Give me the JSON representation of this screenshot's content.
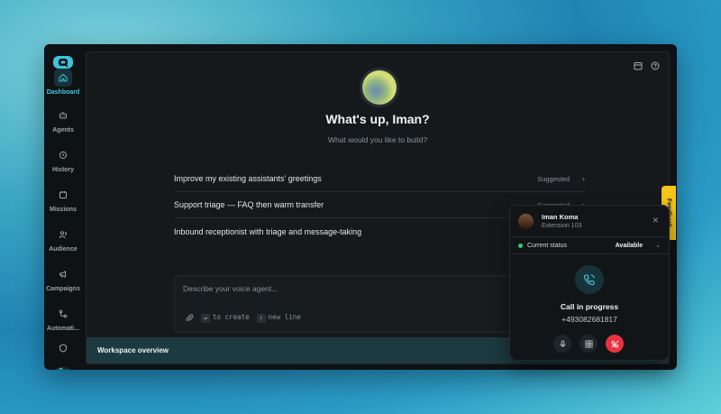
{
  "sidebar": {
    "items": [
      {
        "label": "Dashboard",
        "icon": "home-icon",
        "active": true
      },
      {
        "label": "Agents",
        "icon": "robot-icon"
      },
      {
        "label": "History",
        "icon": "history-icon"
      },
      {
        "label": "Missions",
        "icon": "calendar-clock-icon"
      },
      {
        "label": "Audience",
        "icon": "users-icon"
      },
      {
        "label": "Campaigns",
        "icon": "megaphone-icon"
      },
      {
        "label": "Automati...",
        "icon": "workflow-icon"
      }
    ]
  },
  "main": {
    "greeting": "What's up, Iman?",
    "subtitle": "What would you like to build?",
    "suggestions": [
      {
        "text": "Improve my existing assistants' greetings",
        "tag": "Suggested"
      },
      {
        "text": "Support triage — FAQ then warm transfer",
        "tag": "Suggested"
      },
      {
        "text": "Inbound receptionist with triage and message-taking",
        "tag": ""
      }
    ],
    "composer": {
      "placeholder": "Describe your voice agent...",
      "hint_create": "to create",
      "hint_newline": "new line",
      "create_key": "↵",
      "newline_key": "⇧"
    },
    "overview_label": "Workspace overview"
  },
  "feedback_label": "Feedback",
  "call": {
    "name": "Iman Koma",
    "extension": "Extension 103",
    "status_label": "Current status",
    "status_value": "Available",
    "state": "Call in progress",
    "number": "+493082681817"
  },
  "colors": {
    "accent": "#3ec4e0",
    "danger": "#e8333f",
    "online": "#2ecc71",
    "feedback": "#f5c518"
  }
}
